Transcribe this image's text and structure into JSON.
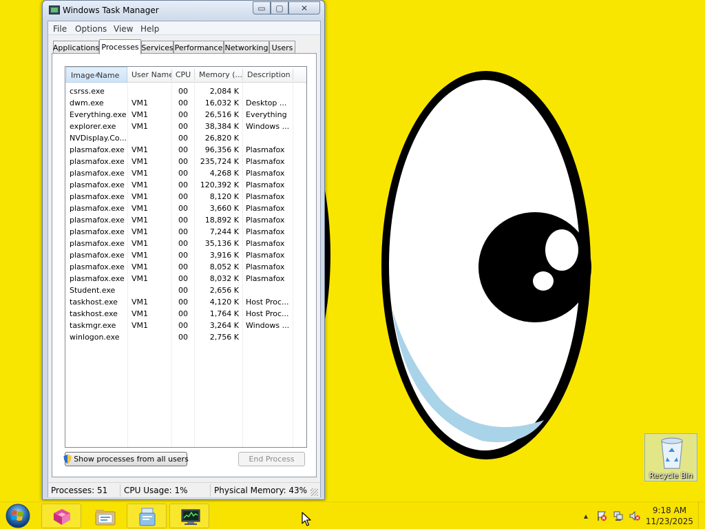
{
  "window": {
    "title": "Windows Task Manager",
    "minimize_glyph": "▭",
    "maximize_glyph": "▢",
    "close_glyph": "✕"
  },
  "menu": [
    "File",
    "Options",
    "View",
    "Help"
  ],
  "tabs": [
    "Applications",
    "Processes",
    "Services",
    "Performance",
    "Networking",
    "Users"
  ],
  "active_tab": "Processes",
  "columns": [
    "Image Name",
    "User Name",
    "CPU",
    "Memory (...",
    "Description"
  ],
  "processes": [
    {
      "name": "csrss.exe",
      "user": "",
      "cpu": "00",
      "memory": "2,084 K",
      "description": ""
    },
    {
      "name": "dwm.exe",
      "user": "VM1",
      "cpu": "00",
      "memory": "16,032 K",
      "description": "Desktop ..."
    },
    {
      "name": "Everything.exe",
      "user": "VM1",
      "cpu": "00",
      "memory": "26,516 K",
      "description": "Everything"
    },
    {
      "name": "explorer.exe",
      "user": "VM1",
      "cpu": "00",
      "memory": "38,384 K",
      "description": "Windows ..."
    },
    {
      "name": "NVDisplay.Co...",
      "user": "",
      "cpu": "00",
      "memory": "26,820 K",
      "description": ""
    },
    {
      "name": "plasmafox.exe",
      "user": "VM1",
      "cpu": "00",
      "memory": "96,356 K",
      "description": "Plasmafox"
    },
    {
      "name": "plasmafox.exe",
      "user": "VM1",
      "cpu": "00",
      "memory": "235,724 K",
      "description": "Plasmafox"
    },
    {
      "name": "plasmafox.exe",
      "user": "VM1",
      "cpu": "00",
      "memory": "4,268 K",
      "description": "Plasmafox"
    },
    {
      "name": "plasmafox.exe",
      "user": "VM1",
      "cpu": "00",
      "memory": "120,392 K",
      "description": "Plasmafox"
    },
    {
      "name": "plasmafox.exe",
      "user": "VM1",
      "cpu": "00",
      "memory": "8,120 K",
      "description": "Plasmafox"
    },
    {
      "name": "plasmafox.exe",
      "user": "VM1",
      "cpu": "00",
      "memory": "3,660 K",
      "description": "Plasmafox"
    },
    {
      "name": "plasmafox.exe",
      "user": "VM1",
      "cpu": "00",
      "memory": "18,892 K",
      "description": "Plasmafox"
    },
    {
      "name": "plasmafox.exe",
      "user": "VM1",
      "cpu": "00",
      "memory": "7,244 K",
      "description": "Plasmafox"
    },
    {
      "name": "plasmafox.exe",
      "user": "VM1",
      "cpu": "00",
      "memory": "35,136 K",
      "description": "Plasmafox"
    },
    {
      "name": "plasmafox.exe",
      "user": "VM1",
      "cpu": "00",
      "memory": "3,916 K",
      "description": "Plasmafox"
    },
    {
      "name": "plasmafox.exe",
      "user": "VM1",
      "cpu": "00",
      "memory": "8,052 K",
      "description": "Plasmafox"
    },
    {
      "name": "plasmafox.exe",
      "user": "VM1",
      "cpu": "00",
      "memory": "8,032 K",
      "description": "Plasmafox"
    },
    {
      "name": "Student.exe",
      "user": "",
      "cpu": "00",
      "memory": "2,656 K",
      "description": ""
    },
    {
      "name": "taskhost.exe",
      "user": "VM1",
      "cpu": "00",
      "memory": "4,120 K",
      "description": "Host Proc..."
    },
    {
      "name": "taskhost.exe",
      "user": "VM1",
      "cpu": "00",
      "memory": "1,764 K",
      "description": "Host Proc..."
    },
    {
      "name": "taskmgr.exe",
      "user": "VM1",
      "cpu": "00",
      "memory": "3,264 K",
      "description": "Windows ..."
    },
    {
      "name": "winlogon.exe",
      "user": "",
      "cpu": "00",
      "memory": "2,756 K",
      "description": ""
    }
  ],
  "buttons": {
    "show_all": "Show processes from all users",
    "end_process": "End Process"
  },
  "status": {
    "processes": "Processes: 51",
    "cpu": "CPU Usage: 1%",
    "memory": "Physical Memory: 43%"
  },
  "desktop": {
    "recycle_bin_label": "Recycle Bin",
    "wallpaper_color": "#f9e600"
  },
  "taskbar": {
    "pinned_apps": [
      "start-orb",
      "plasmafox",
      "file-explorer",
      "document-viewer",
      "task-manager"
    ],
    "tray_icons": [
      "show-hidden-icons-arrow",
      "action-center-flag",
      "network-icon",
      "volume-muted-icon"
    ],
    "tray_arrow_glyph": "▲",
    "time": "9:18 AM",
    "date": "11/23/2025"
  }
}
